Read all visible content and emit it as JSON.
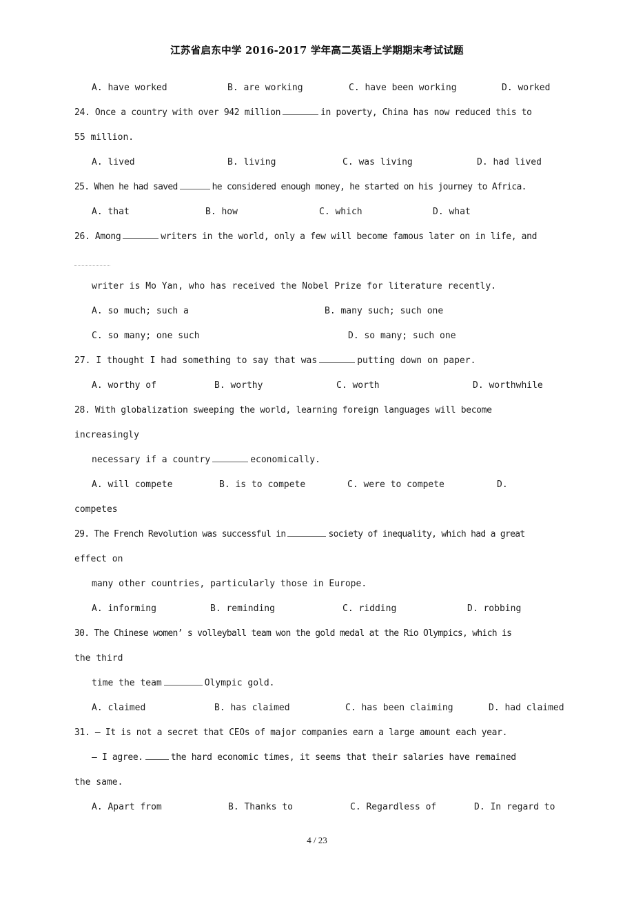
{
  "document": {
    "title": "江苏省启东中学 2016-2017 学年高二英语上学期期末考试试题",
    "page_footer": "4 / 23"
  },
  "carryover_options": {
    "a": "A. have worked",
    "b": "B. are working",
    "c": "C. have been working",
    "d": "D. worked"
  },
  "questions": [
    {
      "number": "24.",
      "stem_line1": "24. Once a country with over 942 million",
      "stem_line1_tail": "in poverty, China has now reduced this to",
      "stem_line2": "55 million.",
      "options": {
        "a": "A. lived",
        "b": "B. living",
        "c": "C. was living",
        "d": "D. had lived"
      }
    },
    {
      "number": "25.",
      "stem_line1": "25. When he had saved",
      "stem_line1_tail": "he considered enough money, he started on his journey to Africa.",
      "options": {
        "a": "A. that",
        "b": "B. how",
        "c": "C. which",
        "d": "D. what"
      }
    },
    {
      "number": "26.",
      "stem_line1": "26. Among",
      "stem_line1_tail": "writers in the world, only a few will become famous later on in life, and",
      "stem_line3": "writer is Mo Yan, who has received the Nobel Prize for literature recently.",
      "options": {
        "a": "A. so much; such a",
        "b": "B. many such; such one",
        "c": "C. so many; one such",
        "d": "D. so many; such one"
      }
    },
    {
      "number": "27.",
      "stem_line1": "27. I thought I had something to say that was",
      "stem_line1_tail": "putting down on paper.",
      "options": {
        "a": "A. worthy of",
        "b": "B. worthy",
        "c": "C. worth",
        "d": "D. worthwhile"
      }
    },
    {
      "number": "28.",
      "stem_line1": "28. With globalization sweeping the world, learning foreign languages will become",
      "stem_line2": "increasingly",
      "stem_line3": "necessary if a country",
      "stem_line3_tail": "economically.",
      "options": {
        "a": "A. will compete",
        "b": "B. is to compete",
        "c": "C. were to compete",
        "d": "D.",
        "d_overflow": "competes"
      }
    },
    {
      "number": "29.",
      "stem_line1": "29. The French Revolution was successful in",
      "stem_line1_tail": "society of inequality, which had a great",
      "stem_line2": "effect on",
      "stem_line3": "many other countries, particularly those in Europe.",
      "options": {
        "a": "A. informing",
        "b": "B. reminding",
        "c": "C. ridding",
        "d": "D. robbing"
      }
    },
    {
      "number": "30.",
      "stem_line1": "30. The Chinese women’ s volleyball team won the gold medal at the Rio Olympics, which is",
      "stem_line2": "the third",
      "stem_line3": "time the team",
      "stem_line3_tail": "Olympic gold.",
      "options": {
        "a": "A. claimed",
        "b": "B. has claimed",
        "c": "C. has been claiming",
        "d": "D. had claimed"
      }
    },
    {
      "number": "31.",
      "stem_line1": "31. — It is not a secret that CEOs of major companies earn a large amount each year.",
      "stem_line2": "— I agree.",
      "stem_line2_tail": "the hard economic times, it seems that their salaries have remained",
      "stem_line3": "the same.",
      "options": {
        "a": "A. Apart from",
        "b": "B. Thanks to",
        "c": "C. Regardless of",
        "d": "D. In regard to"
      }
    }
  ]
}
